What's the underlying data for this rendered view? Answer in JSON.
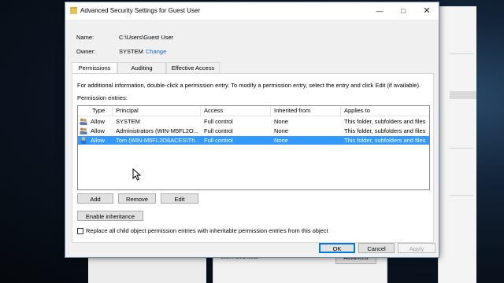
{
  "dialog": {
    "title": "Advanced Security Settings for Guest User",
    "name_label": "Name:",
    "name_value": "C:\\Users\\Guest User",
    "owner_label": "Owner:",
    "owner_value": "SYSTEM",
    "change_link": "Change"
  },
  "tabs": [
    "Permissions",
    "Auditing",
    "Effective Access"
  ],
  "panel": {
    "info": "For additional information, double-click a permission entry. To modify a permission entry, select the entry and click Edit (if available).",
    "entries_label": "Permission entries:",
    "columns": [
      "Type",
      "Principal",
      "Access",
      "Inherited from",
      "Applies to"
    ],
    "rows": [
      {
        "type": "Allow",
        "principal": "SYSTEM",
        "access": "Full control",
        "inherited": "None",
        "applies": "This folder, subfolders and files"
      },
      {
        "type": "Allow",
        "principal": "Administrators (WIN-M5FL2O...",
        "access": "Full control",
        "inherited": "None",
        "applies": "This folder, subfolders and files"
      },
      {
        "type": "Allow",
        "principal": "Tom (WIN-M5FL2O6ACES\\Th...",
        "access": "Full control",
        "inherited": "None",
        "applies": "This folder, subfolders and files"
      }
    ],
    "add": "Add",
    "remove": "Remove",
    "edit": "Edit",
    "enable_inheritance": "Enable inheritance",
    "replace_checkbox": "Replace all child object permission entries with inheritable permission entries from this object"
  },
  "footer": {
    "ok": "OK",
    "cancel": "Cancel",
    "apply": "Apply"
  },
  "background": {
    "text": "click Advanced.",
    "button": "Advanced"
  },
  "colors": {
    "selection": "#3399ff",
    "link": "#1a64c8"
  }
}
